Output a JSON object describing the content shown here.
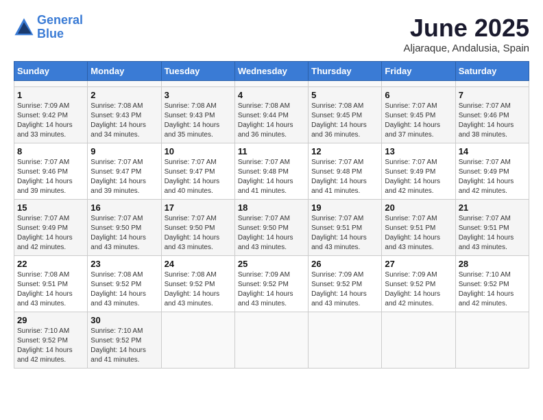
{
  "header": {
    "logo_line1": "General",
    "logo_line2": "Blue",
    "month_title": "June 2025",
    "location": "Aljaraque, Andalusia, Spain"
  },
  "calendar": {
    "days_of_week": [
      "Sunday",
      "Monday",
      "Tuesday",
      "Wednesday",
      "Thursday",
      "Friday",
      "Saturday"
    ],
    "weeks": [
      [
        {
          "day": "",
          "info": ""
        },
        {
          "day": "",
          "info": ""
        },
        {
          "day": "",
          "info": ""
        },
        {
          "day": "",
          "info": ""
        },
        {
          "day": "",
          "info": ""
        },
        {
          "day": "",
          "info": ""
        },
        {
          "day": "",
          "info": ""
        }
      ],
      [
        {
          "day": "1",
          "info": "Sunrise: 7:09 AM\nSunset: 9:42 PM\nDaylight: 14 hours\nand 33 minutes."
        },
        {
          "day": "2",
          "info": "Sunrise: 7:08 AM\nSunset: 9:43 PM\nDaylight: 14 hours\nand 34 minutes."
        },
        {
          "day": "3",
          "info": "Sunrise: 7:08 AM\nSunset: 9:43 PM\nDaylight: 14 hours\nand 35 minutes."
        },
        {
          "day": "4",
          "info": "Sunrise: 7:08 AM\nSunset: 9:44 PM\nDaylight: 14 hours\nand 36 minutes."
        },
        {
          "day": "5",
          "info": "Sunrise: 7:08 AM\nSunset: 9:45 PM\nDaylight: 14 hours\nand 36 minutes."
        },
        {
          "day": "6",
          "info": "Sunrise: 7:07 AM\nSunset: 9:45 PM\nDaylight: 14 hours\nand 37 minutes."
        },
        {
          "day": "7",
          "info": "Sunrise: 7:07 AM\nSunset: 9:46 PM\nDaylight: 14 hours\nand 38 minutes."
        }
      ],
      [
        {
          "day": "8",
          "info": "Sunrise: 7:07 AM\nSunset: 9:46 PM\nDaylight: 14 hours\nand 39 minutes."
        },
        {
          "day": "9",
          "info": "Sunrise: 7:07 AM\nSunset: 9:47 PM\nDaylight: 14 hours\nand 39 minutes."
        },
        {
          "day": "10",
          "info": "Sunrise: 7:07 AM\nSunset: 9:47 PM\nDaylight: 14 hours\nand 40 minutes."
        },
        {
          "day": "11",
          "info": "Sunrise: 7:07 AM\nSunset: 9:48 PM\nDaylight: 14 hours\nand 41 minutes."
        },
        {
          "day": "12",
          "info": "Sunrise: 7:07 AM\nSunset: 9:48 PM\nDaylight: 14 hours\nand 41 minutes."
        },
        {
          "day": "13",
          "info": "Sunrise: 7:07 AM\nSunset: 9:49 PM\nDaylight: 14 hours\nand 42 minutes."
        },
        {
          "day": "14",
          "info": "Sunrise: 7:07 AM\nSunset: 9:49 PM\nDaylight: 14 hours\nand 42 minutes."
        }
      ],
      [
        {
          "day": "15",
          "info": "Sunrise: 7:07 AM\nSunset: 9:49 PM\nDaylight: 14 hours\nand 42 minutes."
        },
        {
          "day": "16",
          "info": "Sunrise: 7:07 AM\nSunset: 9:50 PM\nDaylight: 14 hours\nand 43 minutes."
        },
        {
          "day": "17",
          "info": "Sunrise: 7:07 AM\nSunset: 9:50 PM\nDaylight: 14 hours\nand 43 minutes."
        },
        {
          "day": "18",
          "info": "Sunrise: 7:07 AM\nSunset: 9:50 PM\nDaylight: 14 hours\nand 43 minutes."
        },
        {
          "day": "19",
          "info": "Sunrise: 7:07 AM\nSunset: 9:51 PM\nDaylight: 14 hours\nand 43 minutes."
        },
        {
          "day": "20",
          "info": "Sunrise: 7:07 AM\nSunset: 9:51 PM\nDaylight: 14 hours\nand 43 minutes."
        },
        {
          "day": "21",
          "info": "Sunrise: 7:07 AM\nSunset: 9:51 PM\nDaylight: 14 hours\nand 43 minutes."
        }
      ],
      [
        {
          "day": "22",
          "info": "Sunrise: 7:08 AM\nSunset: 9:51 PM\nDaylight: 14 hours\nand 43 minutes."
        },
        {
          "day": "23",
          "info": "Sunrise: 7:08 AM\nSunset: 9:52 PM\nDaylight: 14 hours\nand 43 minutes."
        },
        {
          "day": "24",
          "info": "Sunrise: 7:08 AM\nSunset: 9:52 PM\nDaylight: 14 hours\nand 43 minutes."
        },
        {
          "day": "25",
          "info": "Sunrise: 7:09 AM\nSunset: 9:52 PM\nDaylight: 14 hours\nand 43 minutes."
        },
        {
          "day": "26",
          "info": "Sunrise: 7:09 AM\nSunset: 9:52 PM\nDaylight: 14 hours\nand 43 minutes."
        },
        {
          "day": "27",
          "info": "Sunrise: 7:09 AM\nSunset: 9:52 PM\nDaylight: 14 hours\nand 42 minutes."
        },
        {
          "day": "28",
          "info": "Sunrise: 7:10 AM\nSunset: 9:52 PM\nDaylight: 14 hours\nand 42 minutes."
        }
      ],
      [
        {
          "day": "29",
          "info": "Sunrise: 7:10 AM\nSunset: 9:52 PM\nDaylight: 14 hours\nand 42 minutes."
        },
        {
          "day": "30",
          "info": "Sunrise: 7:10 AM\nSunset: 9:52 PM\nDaylight: 14 hours\nand 41 minutes."
        },
        {
          "day": "",
          "info": ""
        },
        {
          "day": "",
          "info": ""
        },
        {
          "day": "",
          "info": ""
        },
        {
          "day": "",
          "info": ""
        },
        {
          "day": "",
          "info": ""
        }
      ]
    ]
  }
}
